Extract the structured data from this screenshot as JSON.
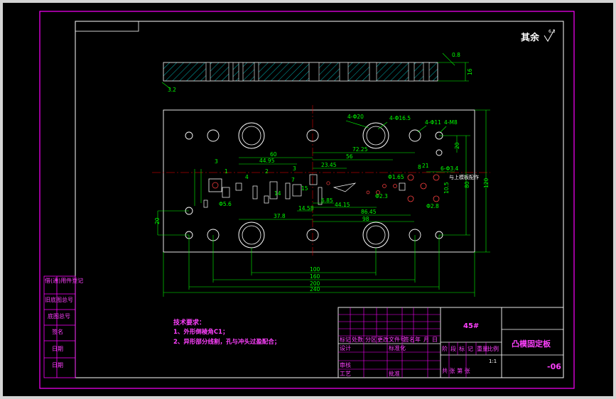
{
  "drawing": {
    "surface_symbol": "其余",
    "surface_finish": "6.3",
    "material": "45#",
    "part_name": "凸模固定板",
    "drawing_number": "-06",
    "tech_title": "技术要求：",
    "tech_items": [
      "1、外形倒棱角C1；",
      "2、异形部分线割，孔与冲头过盈配合；"
    ]
  },
  "left_strip": [
    "借(通)用件登记",
    "旧底图总号",
    "底图总号",
    "签名",
    "日期",
    "日期"
  ],
  "title_block": {
    "header": [
      "标记",
      "处数",
      "分区",
      "更改文件号",
      "签名",
      "年",
      "月",
      "日"
    ],
    "rows_left": [
      "设计",
      "",
      "审核",
      "工艺"
    ],
    "rows_mid": [
      "标准化",
      "批准",
      "",
      ""
    ],
    "stage_headers": [
      "阶",
      "段",
      "标",
      "记",
      "重量",
      "比例"
    ],
    "scale": "1:1",
    "sheet": "共 张 第 张"
  },
  "dimensions": {
    "side_view": {
      "left_dim": "3.2",
      "height": "16",
      "roughness": "0.8",
      "bottom_rough": "0.8"
    },
    "holes": [
      "4-Φ20",
      "4-Φ16.5",
      "4-Φ11",
      "4-M8",
      "6-Φ3.4",
      "Φ5.6",
      "Φ2.3",
      "Φ1.65",
      "Φ2.8"
    ],
    "horizontal": [
      "60",
      "44.95",
      "72.25",
      "56",
      "23.45",
      "37.8",
      "14.58",
      "6.85",
      "44.15",
      "86.45",
      "98",
      "100",
      "160",
      "200",
      "240"
    ],
    "vertical": [
      "20",
      "80",
      "120",
      "20",
      "8",
      "21",
      "10.5"
    ],
    "note_right": "与上模板配作",
    "small": [
      "3",
      "1",
      "4",
      "14",
      "2",
      "3",
      "15",
      "7"
    ]
  }
}
